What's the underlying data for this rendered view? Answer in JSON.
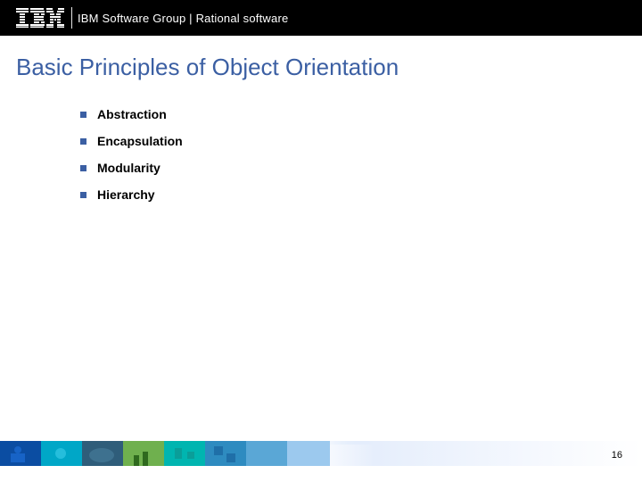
{
  "header": {
    "logo_label": "IBM",
    "breadcrumb": "IBM Software Group | Rational software"
  },
  "title": "Basic Principles of Object Orientation",
  "bullets": [
    "Abstraction",
    "Encapsulation",
    "Modularity",
    "Hierarchy"
  ],
  "page_number": "16",
  "colors": {
    "accent": "#3b5fa3",
    "header_bg": "#000000"
  }
}
